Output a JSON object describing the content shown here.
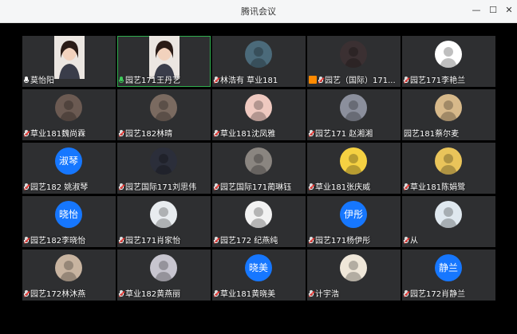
{
  "window": {
    "title": "腾讯会议",
    "min_icon": "minimize-icon",
    "max_icon": "maximize-icon",
    "close_icon": "close-icon"
  },
  "participants": [
    {
      "name": "莫怡阳",
      "mic": "on",
      "kind": "video"
    },
    {
      "name": "园艺171王丹艺",
      "mic": "on-green",
      "kind": "video",
      "active": true
    },
    {
      "name": "林浩有 草业181",
      "mic": "muted",
      "kind": "photo",
      "color": "#4b6a7a"
    },
    {
      "name": "园艺（国际）171...",
      "mic": "muted",
      "kind": "photo",
      "color": "#3b3032",
      "host": true
    },
    {
      "name": "园艺171李艳兰",
      "mic": "muted",
      "kind": "photo",
      "color": "#ffffff"
    },
    {
      "name": "草业181魏尚霖",
      "mic": "muted",
      "kind": "photo",
      "color": "#6b5a52"
    },
    {
      "name": "园艺182林晴",
      "mic": "muted",
      "kind": "photo",
      "color": "#7a6a60"
    },
    {
      "name": "草业181沈凤雅",
      "mic": "muted",
      "kind": "photo",
      "color": "#efc9c0"
    },
    {
      "name": "园艺171 赵湘湘",
      "mic": "muted",
      "kind": "photo",
      "color": "#8b8f9c"
    },
    {
      "name": "园艺181蔡尔麦",
      "mic": "none",
      "kind": "photo",
      "color": "#d7b98a"
    },
    {
      "name": "园艺182 姚淑琴",
      "mic": "muted",
      "kind": "text",
      "label": "淑琴"
    },
    {
      "name": "园艺国际171刘思伟",
      "mic": "muted",
      "kind": "photo",
      "color": "#2b2e3a"
    },
    {
      "name": "园艺国际171蔺琳钰",
      "mic": "muted",
      "kind": "photo",
      "color": "#8a8580"
    },
    {
      "name": "草业181张庆威",
      "mic": "muted",
      "kind": "photo",
      "color": "#f5d142"
    },
    {
      "name": "草业181陈娟鹭",
      "mic": "muted",
      "kind": "photo",
      "color": "#e9c45a"
    },
    {
      "name": "园艺182李晓怡",
      "mic": "muted",
      "kind": "text",
      "label": "晓怡"
    },
    {
      "name": "园艺171肖家怡",
      "mic": "muted",
      "kind": "photo",
      "color": "#e8ecef"
    },
    {
      "name": "园艺172 纪燕纯",
      "mic": "muted",
      "kind": "photo",
      "color": "#f2f2f2"
    },
    {
      "name": "园艺171杨伊彤",
      "mic": "muted",
      "kind": "text",
      "label": "伊彤"
    },
    {
      "name": "从",
      "mic": "muted",
      "kind": "photo",
      "color": "#dfe8ef"
    },
    {
      "name": "园艺172林沐燕",
      "mic": "muted",
      "kind": "photo",
      "color": "#c8b4a0"
    },
    {
      "name": "草业182黄燕丽",
      "mic": "muted",
      "kind": "photo",
      "color": "#c7c5cf"
    },
    {
      "name": "草业181黄晓美",
      "mic": "muted",
      "kind": "text",
      "label": "晓美"
    },
    {
      "name": "计宇浩",
      "mic": "muted",
      "kind": "photo",
      "color": "#efe7d9"
    },
    {
      "name": "园艺172肖静兰",
      "mic": "muted",
      "kind": "text",
      "label": "静兰"
    }
  ]
}
